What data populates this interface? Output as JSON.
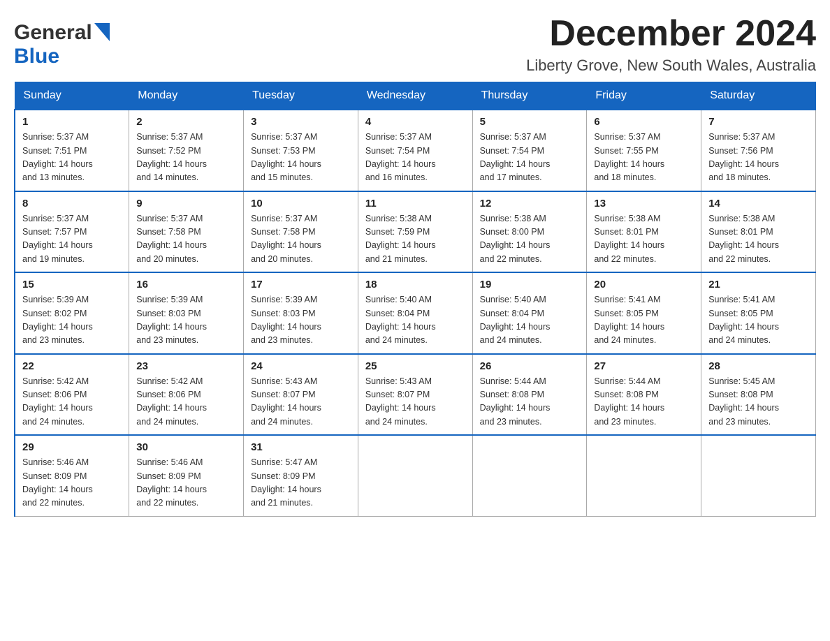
{
  "header": {
    "logo_general": "General",
    "logo_blue": "Blue",
    "month_year": "December 2024",
    "location": "Liberty Grove, New South Wales, Australia"
  },
  "weekdays": [
    "Sunday",
    "Monday",
    "Tuesday",
    "Wednesday",
    "Thursday",
    "Friday",
    "Saturday"
  ],
  "weeks": [
    [
      {
        "day": "1",
        "sunrise": "5:37 AM",
        "sunset": "7:51 PM",
        "daylight": "14 hours and 13 minutes."
      },
      {
        "day": "2",
        "sunrise": "5:37 AM",
        "sunset": "7:52 PM",
        "daylight": "14 hours and 14 minutes."
      },
      {
        "day": "3",
        "sunrise": "5:37 AM",
        "sunset": "7:53 PM",
        "daylight": "14 hours and 15 minutes."
      },
      {
        "day": "4",
        "sunrise": "5:37 AM",
        "sunset": "7:54 PM",
        "daylight": "14 hours and 16 minutes."
      },
      {
        "day": "5",
        "sunrise": "5:37 AM",
        "sunset": "7:54 PM",
        "daylight": "14 hours and 17 minutes."
      },
      {
        "day": "6",
        "sunrise": "5:37 AM",
        "sunset": "7:55 PM",
        "daylight": "14 hours and 18 minutes."
      },
      {
        "day": "7",
        "sunrise": "5:37 AM",
        "sunset": "7:56 PM",
        "daylight": "14 hours and 18 minutes."
      }
    ],
    [
      {
        "day": "8",
        "sunrise": "5:37 AM",
        "sunset": "7:57 PM",
        "daylight": "14 hours and 19 minutes."
      },
      {
        "day": "9",
        "sunrise": "5:37 AM",
        "sunset": "7:58 PM",
        "daylight": "14 hours and 20 minutes."
      },
      {
        "day": "10",
        "sunrise": "5:37 AM",
        "sunset": "7:58 PM",
        "daylight": "14 hours and 20 minutes."
      },
      {
        "day": "11",
        "sunrise": "5:38 AM",
        "sunset": "7:59 PM",
        "daylight": "14 hours and 21 minutes."
      },
      {
        "day": "12",
        "sunrise": "5:38 AM",
        "sunset": "8:00 PM",
        "daylight": "14 hours and 22 minutes."
      },
      {
        "day": "13",
        "sunrise": "5:38 AM",
        "sunset": "8:01 PM",
        "daylight": "14 hours and 22 minutes."
      },
      {
        "day": "14",
        "sunrise": "5:38 AM",
        "sunset": "8:01 PM",
        "daylight": "14 hours and 22 minutes."
      }
    ],
    [
      {
        "day": "15",
        "sunrise": "5:39 AM",
        "sunset": "8:02 PM",
        "daylight": "14 hours and 23 minutes."
      },
      {
        "day": "16",
        "sunrise": "5:39 AM",
        "sunset": "8:03 PM",
        "daylight": "14 hours and 23 minutes."
      },
      {
        "day": "17",
        "sunrise": "5:39 AM",
        "sunset": "8:03 PM",
        "daylight": "14 hours and 23 minutes."
      },
      {
        "day": "18",
        "sunrise": "5:40 AM",
        "sunset": "8:04 PM",
        "daylight": "14 hours and 24 minutes."
      },
      {
        "day": "19",
        "sunrise": "5:40 AM",
        "sunset": "8:04 PM",
        "daylight": "14 hours and 24 minutes."
      },
      {
        "day": "20",
        "sunrise": "5:41 AM",
        "sunset": "8:05 PM",
        "daylight": "14 hours and 24 minutes."
      },
      {
        "day": "21",
        "sunrise": "5:41 AM",
        "sunset": "8:05 PM",
        "daylight": "14 hours and 24 minutes."
      }
    ],
    [
      {
        "day": "22",
        "sunrise": "5:42 AM",
        "sunset": "8:06 PM",
        "daylight": "14 hours and 24 minutes."
      },
      {
        "day": "23",
        "sunrise": "5:42 AM",
        "sunset": "8:06 PM",
        "daylight": "14 hours and 24 minutes."
      },
      {
        "day": "24",
        "sunrise": "5:43 AM",
        "sunset": "8:07 PM",
        "daylight": "14 hours and 24 minutes."
      },
      {
        "day": "25",
        "sunrise": "5:43 AM",
        "sunset": "8:07 PM",
        "daylight": "14 hours and 24 minutes."
      },
      {
        "day": "26",
        "sunrise": "5:44 AM",
        "sunset": "8:08 PM",
        "daylight": "14 hours and 23 minutes."
      },
      {
        "day": "27",
        "sunrise": "5:44 AM",
        "sunset": "8:08 PM",
        "daylight": "14 hours and 23 minutes."
      },
      {
        "day": "28",
        "sunrise": "5:45 AM",
        "sunset": "8:08 PM",
        "daylight": "14 hours and 23 minutes."
      }
    ],
    [
      {
        "day": "29",
        "sunrise": "5:46 AM",
        "sunset": "8:09 PM",
        "daylight": "14 hours and 22 minutes."
      },
      {
        "day": "30",
        "sunrise": "5:46 AM",
        "sunset": "8:09 PM",
        "daylight": "14 hours and 22 minutes."
      },
      {
        "day": "31",
        "sunrise": "5:47 AM",
        "sunset": "8:09 PM",
        "daylight": "14 hours and 21 minutes."
      },
      null,
      null,
      null,
      null
    ]
  ],
  "labels": {
    "sunrise": "Sunrise:",
    "sunset": "Sunset:",
    "daylight": "Daylight:"
  }
}
